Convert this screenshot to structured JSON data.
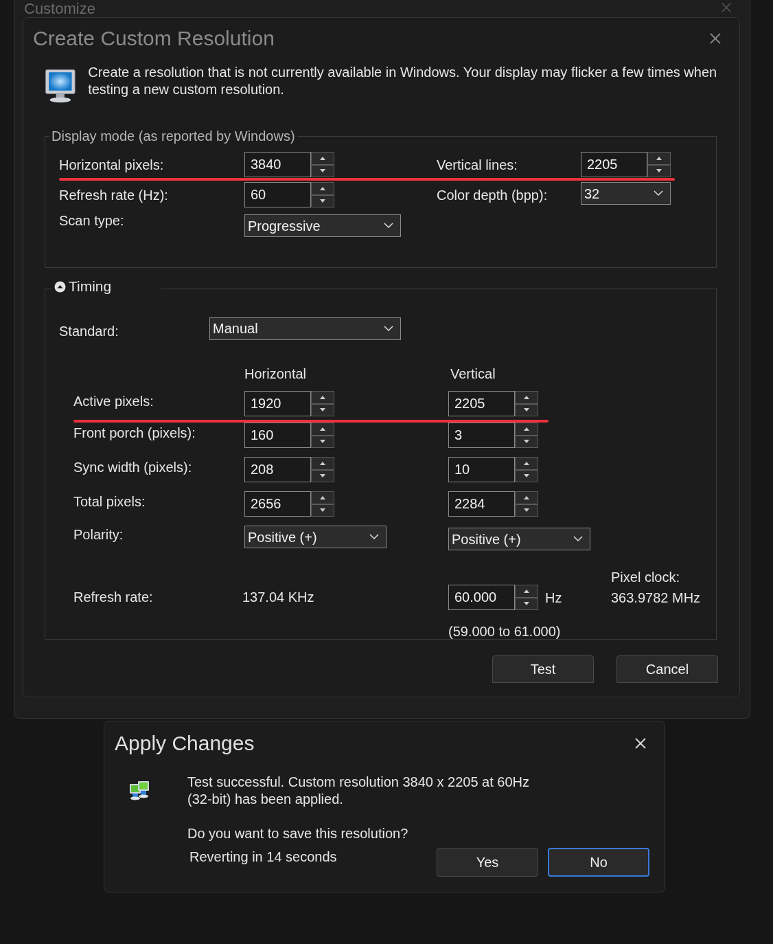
{
  "background_window": {
    "title": "Customize"
  },
  "dialog": {
    "title": "Create Custom Resolution",
    "active": false,
    "intro": "Create a resolution that is not currently available in Windows. Your display may flicker a few times when testing a new custom resolution.",
    "display_mode": {
      "legend": "Display mode (as reported by Windows)",
      "rows": [
        {
          "underlined": true,
          "fields": [
            {
              "label": "Horizontal pixels:",
              "kind": "spinner",
              "value": "3840"
            },
            {
              "label": "Vertical lines:",
              "kind": "spinner",
              "value": "2205"
            }
          ]
        },
        {
          "underlined": false,
          "fields": [
            {
              "label": "Refresh rate (Hz):",
              "kind": "spinner",
              "value": "60"
            },
            {
              "label": "Color depth (bpp):",
              "kind": "dropdown",
              "value": "32"
            }
          ]
        },
        {
          "underlined": false,
          "fields": [
            {
              "label": "Scan type:",
              "kind": "dropdown",
              "value": "Progressive"
            }
          ]
        }
      ]
    },
    "timing": {
      "legend": "Timing",
      "expanded": true,
      "standard": {
        "label": "Standard:",
        "value": "Manual"
      },
      "columns": [
        "Horizontal",
        "Vertical"
      ],
      "rows": [
        {
          "label": "Active pixels:",
          "underlined": true,
          "horizontal": {
            "kind": "spinner",
            "value": "1920"
          },
          "vertical": {
            "kind": "spinner",
            "value": "2205"
          }
        },
        {
          "label": "Front porch (pixels):",
          "underlined": false,
          "horizontal": {
            "kind": "spinner",
            "value": "160"
          },
          "vertical": {
            "kind": "spinner",
            "value": "3"
          }
        },
        {
          "label": "Sync width (pixels):",
          "underlined": false,
          "horizontal": {
            "kind": "spinner",
            "value": "208"
          },
          "vertical": {
            "kind": "spinner",
            "value": "10"
          }
        },
        {
          "label": "Total pixels:",
          "underlined": false,
          "horizontal": {
            "kind": "spinner",
            "value": "2656"
          },
          "vertical": {
            "kind": "spinner",
            "value": "2284"
          }
        },
        {
          "label": "Polarity:",
          "underlined": false,
          "horizontal": {
            "kind": "dropdown",
            "value": "Positive (+)"
          },
          "vertical": {
            "kind": "dropdown",
            "value": "Positive (+)"
          }
        }
      ],
      "refresh": {
        "label": "Refresh rate:",
        "horizontal": "137.04 KHz",
        "vertical": "60.000",
        "unit": "Hz",
        "range": "(59.000 to 61.000)"
      },
      "pixel_clock": {
        "label": "Pixel clock:",
        "value": "363.9782 MHz"
      }
    },
    "buttons": [
      {
        "label": "Test",
        "default": false
      },
      {
        "label": "Cancel",
        "default": false
      }
    ]
  },
  "apply_dialog": {
    "title": "Apply Changes",
    "active": true,
    "message": "Test successful. Custom resolution 3840 x 2205 at 60Hz (32-bit) has been applied.",
    "question": "Do you want to save this resolution?",
    "countdown": "Reverting in 14 seconds",
    "buttons": [
      {
        "label": "Yes",
        "default": false
      },
      {
        "label": "No",
        "default": true
      }
    ]
  }
}
